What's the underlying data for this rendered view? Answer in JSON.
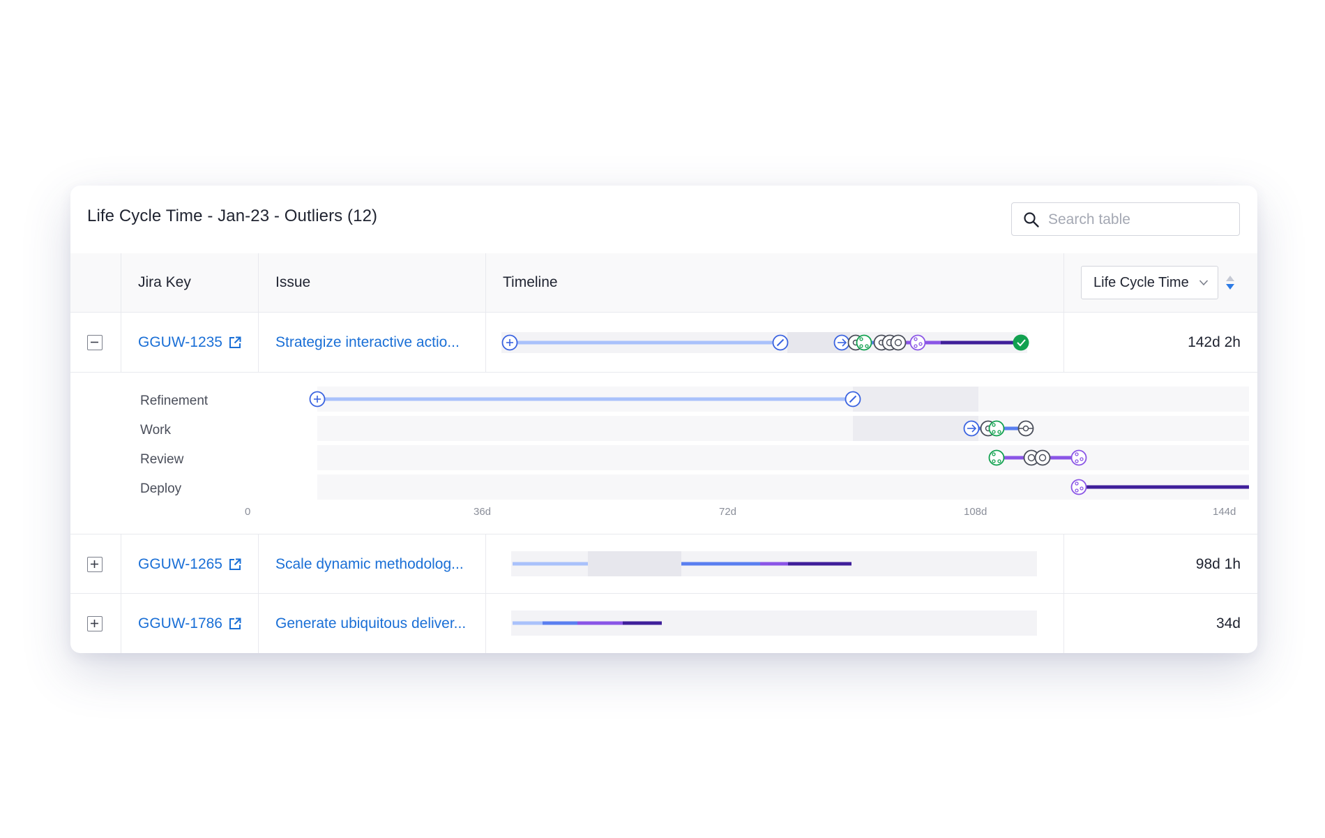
{
  "card": {
    "title": "Life Cycle Time - Jan-23 - Outliers (12)"
  },
  "search": {
    "placeholder": "Search table",
    "value": ""
  },
  "table": {
    "columns": [
      "Jira Key",
      "Issue",
      "Timeline"
    ],
    "sort": {
      "selected": "Life Cycle Time",
      "direction": "descending"
    },
    "rows": [
      {
        "key": "GGUW-1235",
        "issue": "Strategize interactive actio...",
        "duration": "142d 2h",
        "expanded": true
      },
      {
        "key": "GGUW-1265",
        "issue": "Scale dynamic methodolog...",
        "duration": "98d 1h",
        "expanded": false
      },
      {
        "key": "GGUW-1786",
        "issue": "Generate ubiquitous deliver...",
        "duration": "34d",
        "expanded": false
      }
    ]
  },
  "detail": {
    "phases": [
      "Refinement",
      "Work",
      "Review",
      "Deploy"
    ],
    "axis": {
      "ticks": [
        "0",
        "36d",
        "72d",
        "108d",
        "144d"
      ],
      "max_days": 144
    },
    "segments": [
      {
        "phase": "Refinement",
        "start": 0,
        "end": 78.5,
        "color": "#a9c1fb"
      },
      {
        "phase": "Refinement",
        "shade_start": 78.5,
        "shade_end": 96.5
      },
      {
        "phase": "Work",
        "start": 96.5,
        "end": 104.5,
        "color": "#5a7ff0"
      },
      {
        "phase": "Review",
        "start": 100.2,
        "end": 111.5,
        "color": "#8a55e6"
      },
      {
        "phase": "Deploy",
        "start": 111.5,
        "end": 140.9,
        "color": "#3f1f9a"
      }
    ]
  },
  "colors": {
    "link": "#1a6fd6",
    "refinement": "#a9c1fb",
    "work": "#5a7ff0",
    "review": "#8a55e6",
    "deploy": "#3f1f9a",
    "done": "#12a150",
    "code": "#12a150",
    "neutral_icon": "#4a4e5a"
  },
  "icons": [
    "search-icon",
    "chevron-down-icon",
    "sort-arrows-icon",
    "external-link-icon",
    "collapse-icon",
    "expand-icon",
    "created-icon",
    "edit-icon",
    "start-work-icon",
    "commit-icon",
    "pull-request-icon",
    "comment-icon",
    "merge-icon",
    "deployed-check-icon"
  ]
}
